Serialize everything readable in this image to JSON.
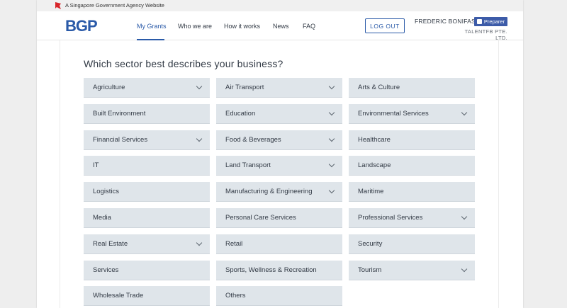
{
  "masthead": {
    "text": "A Singapore Government Agency Website"
  },
  "header": {
    "logo": "BGP",
    "nav": [
      {
        "label": "My Grants"
      },
      {
        "label": "Who we are"
      },
      {
        "label": "How it works"
      },
      {
        "label": "News"
      },
      {
        "label": "FAQ"
      }
    ],
    "logout_label": "LOG OUT",
    "user_name": "FREDERIC BONIFASSY",
    "role": "Preparer",
    "company": "TALENTFB PTE. LTD."
  },
  "main": {
    "question": "Which sector best describes your business?",
    "sectors": [
      {
        "label": "Agriculture",
        "chevron": true
      },
      {
        "label": "Air Transport",
        "chevron": true
      },
      {
        "label": "Arts & Culture",
        "chevron": false
      },
      {
        "label": "Built Environment",
        "chevron": false
      },
      {
        "label": "Education",
        "chevron": true
      },
      {
        "label": "Environmental Services",
        "chevron": true
      },
      {
        "label": "Financial Services",
        "chevron": true
      },
      {
        "label": "Food & Beverages",
        "chevron": true
      },
      {
        "label": "Healthcare",
        "chevron": false
      },
      {
        "label": "IT",
        "chevron": false
      },
      {
        "label": "Land Transport",
        "chevron": true
      },
      {
        "label": "Landscape",
        "chevron": false
      },
      {
        "label": "Logistics",
        "chevron": false
      },
      {
        "label": "Manufacturing & Engineering",
        "chevron": true
      },
      {
        "label": "Maritime",
        "chevron": false
      },
      {
        "label": "Media",
        "chevron": false
      },
      {
        "label": "Personal Care Services",
        "chevron": false
      },
      {
        "label": "Professional Services",
        "chevron": true
      },
      {
        "label": "Real Estate",
        "chevron": true
      },
      {
        "label": "Retail",
        "chevron": false
      },
      {
        "label": "Security",
        "chevron": false
      },
      {
        "label": "Services",
        "chevron": false
      },
      {
        "label": "Sports, Wellness & Recreation",
        "chevron": false
      },
      {
        "label": "Tourism",
        "chevron": true
      },
      {
        "label": "Wholesale Trade",
        "chevron": false
      },
      {
        "label": "Others",
        "chevron": false
      }
    ]
  },
  "colors": {
    "brand": "#2a5aa8",
    "tile_bg": "#dfe5ea",
    "text": "#323a45",
    "masthead_bg": "#f0f0f0",
    "badge_bg": "#3c5ba8"
  }
}
